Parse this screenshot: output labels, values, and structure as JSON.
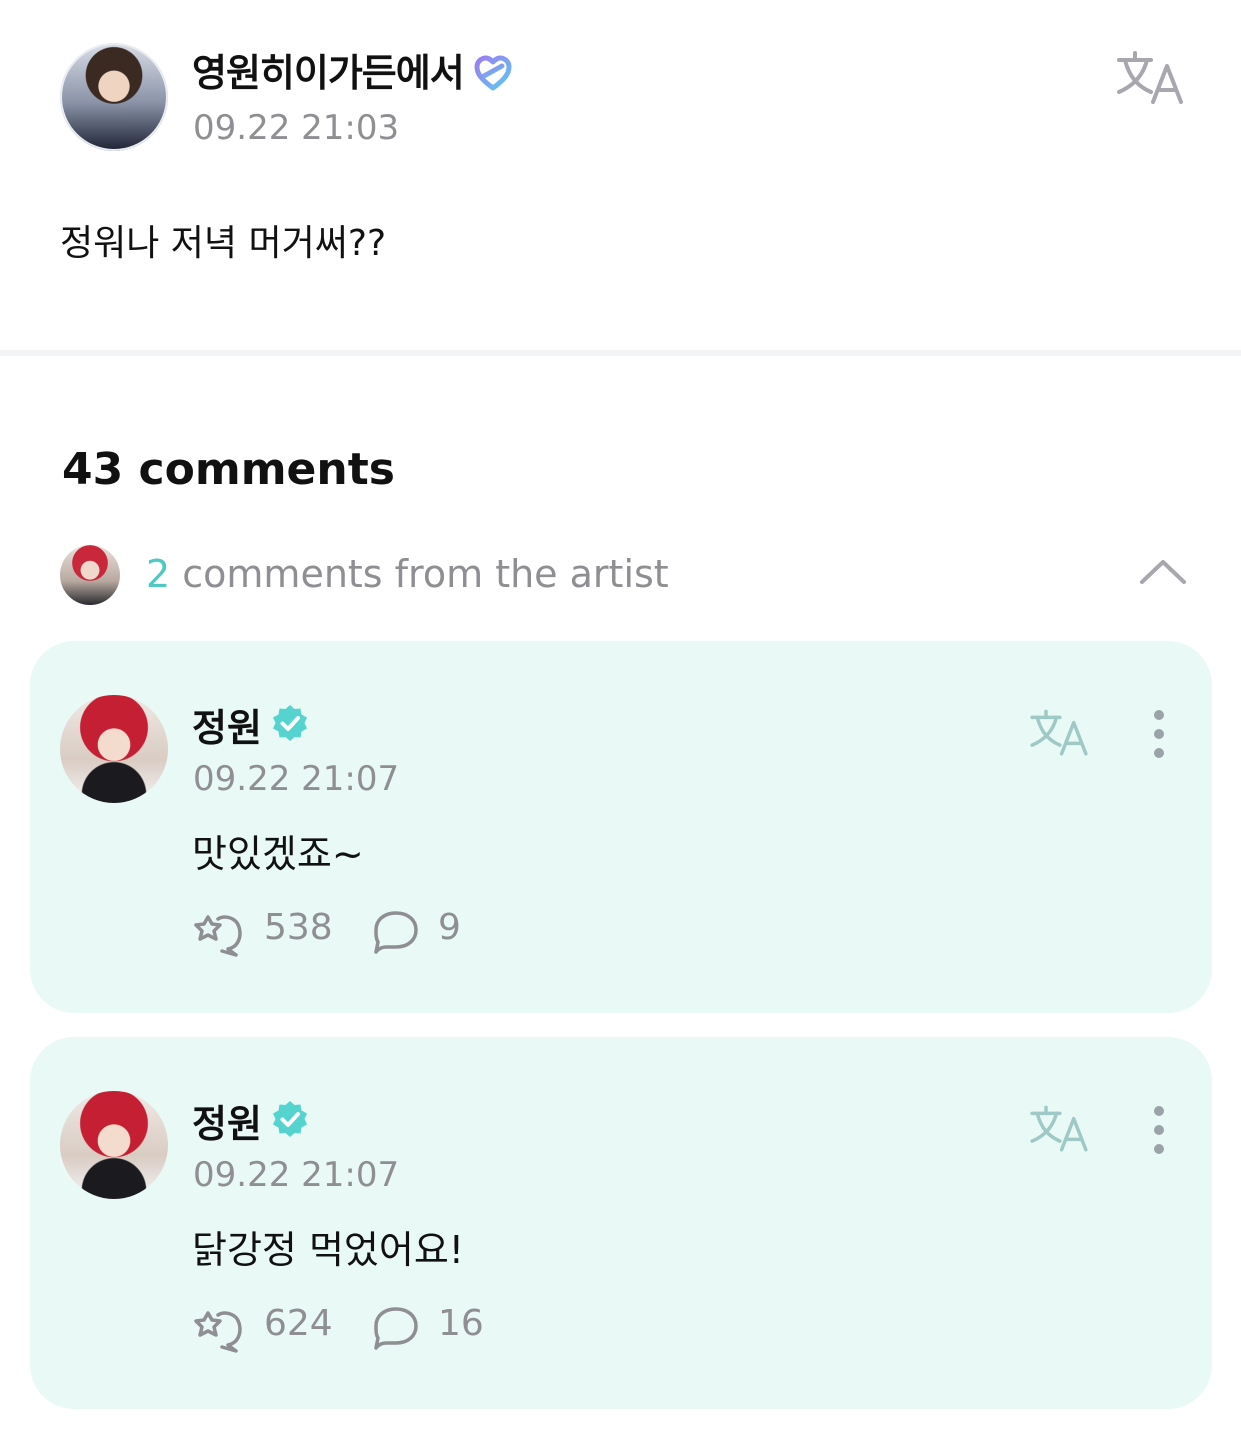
{
  "post": {
    "author": "영원히이가든에서",
    "time": "09.22 21:03",
    "body": "정워나 저녁 머거써??"
  },
  "comments_header": {
    "count_label": "43 comments"
  },
  "artist_summary": {
    "count": "2",
    "label": " comments from the artist"
  },
  "artist_comments": [
    {
      "name": "정원",
      "time": "09.22 21:07",
      "text": "맛있겠죠~",
      "likes": "538",
      "replies": "9"
    },
    {
      "name": "정원",
      "time": "09.22 21:07",
      "text": "닭강정 먹었어요!",
      "likes": "624",
      "replies": "16"
    }
  ],
  "colors": {
    "accent_teal": "#4ec9c2",
    "card_bg": "#e9f9f6",
    "muted": "#8e8e93",
    "verified_gradient": [
      "#8f7cf0",
      "#5ec9f0"
    ]
  },
  "icons": [
    "translate-icon",
    "verified-badge-icon",
    "chevron-up-icon",
    "more-vertical-icon",
    "like-icon",
    "reply-icon"
  ]
}
